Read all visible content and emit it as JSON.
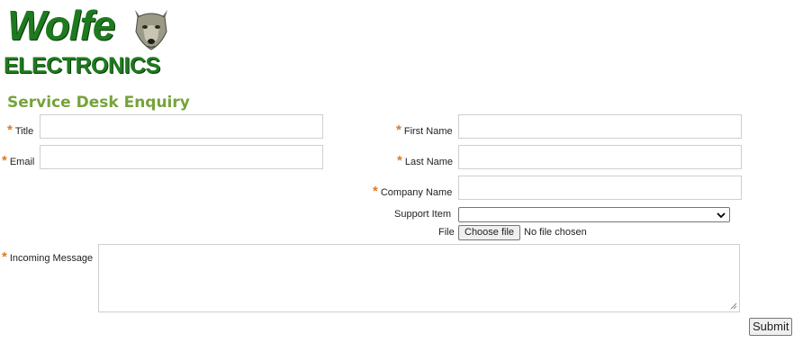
{
  "brand": {
    "name": "Wolfe",
    "subtitle": "ELECTRONICS",
    "accent": "#1e7a1e"
  },
  "form": {
    "heading": "Service Desk Enquiry",
    "required_marker": "*",
    "fields": {
      "title": {
        "label": "Title",
        "value": ""
      },
      "email": {
        "label": "Email",
        "value": ""
      },
      "first_name": {
        "label": "First Name",
        "value": ""
      },
      "last_name": {
        "label": "Last Name",
        "value": ""
      },
      "company_name": {
        "label": "Company Name",
        "value": ""
      },
      "support_item": {
        "label": "Support Item",
        "selected": ""
      },
      "file": {
        "label": "File",
        "button": "Choose file",
        "status": "No file chosen"
      },
      "message": {
        "label": "Incoming Message",
        "value": ""
      }
    },
    "submit_label": "Submit"
  },
  "colors": {
    "heading": "#76a33a",
    "required": "#e07b22"
  }
}
